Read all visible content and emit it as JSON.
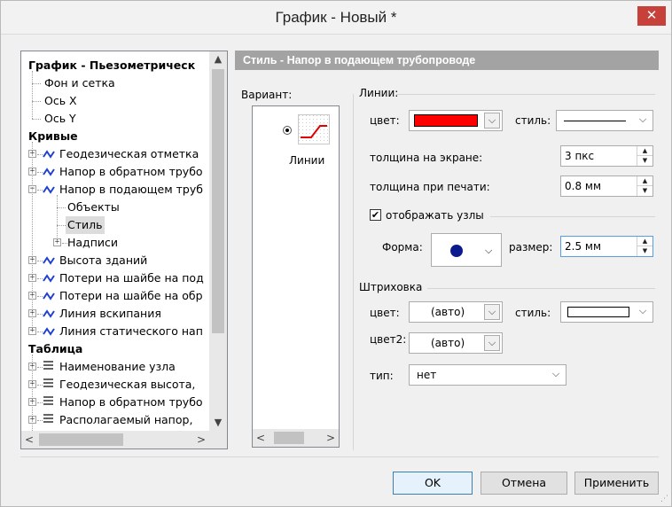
{
  "window": {
    "title": "График - Новый *",
    "close_glyph": "✕"
  },
  "tree": {
    "nodes": [
      {
        "label": "График - Пьезометрическ",
        "bold": true
      },
      {
        "label": "Фон и сетка"
      },
      {
        "label": "Ось X"
      },
      {
        "label": "Ось Y"
      },
      {
        "label": "Кривые",
        "bold": true
      },
      {
        "label": "Геодезическая отметка",
        "icon": "curve-icon",
        "expander": "+"
      },
      {
        "label": "Напор в обратном трубо",
        "icon": "curve-icon",
        "expander": "+"
      },
      {
        "label": "Напор в подающем труб",
        "icon": "curve-icon",
        "expander": "−"
      },
      {
        "label": "Объекты"
      },
      {
        "label": "Стиль",
        "selected": true
      },
      {
        "label": "Надписи",
        "expander": "+"
      },
      {
        "label": "Высота зданий",
        "icon": "curve-icon",
        "expander": "+"
      },
      {
        "label": "Потери на шайбе на под",
        "icon": "curve-icon",
        "expander": "+"
      },
      {
        "label": "Потери на шайбе на обр",
        "icon": "curve-icon",
        "expander": "+"
      },
      {
        "label": "Линия вскипания",
        "icon": "curve-icon",
        "expander": "+"
      },
      {
        "label": "Линия статического нап",
        "icon": "curve-icon",
        "expander": "+"
      },
      {
        "label": "Таблица",
        "bold": true
      },
      {
        "label": "Наименование узла",
        "icon": "table-lines-icon",
        "expander": "+"
      },
      {
        "label": "Геодезическая высота,",
        "icon": "table-lines-icon",
        "expander": "+"
      },
      {
        "label": "Напор в обратном трубо",
        "icon": "table-lines-icon",
        "expander": "+"
      },
      {
        "label": "Располагаемый напор,",
        "icon": "table-lines-icon",
        "expander": "+"
      }
    ],
    "scroll_up": "▲",
    "scroll_down": "▼",
    "scroll_left": "<",
    "scroll_right": ">"
  },
  "panel": {
    "header": "Стиль - Напор в подающем трубопроводе",
    "variant_label": "Вариант:",
    "variant_item_label": "Линии",
    "lines": {
      "group_label": "Линии:",
      "color_label": "цвет:",
      "color_value": "#ff0000",
      "style_label": "стиль:",
      "screen_thickness_label": "толщина на экране:",
      "screen_thickness_value": "3 пкс",
      "print_thickness_label": "толщина при печати:",
      "print_thickness_value": "0.8 мм",
      "show_nodes_label": "отображать узлы",
      "show_nodes_checked": true,
      "shape_label": "Форма:",
      "size_label": "размер:",
      "size_value": "2.5 мм"
    },
    "hatch": {
      "group_label": "Штриховка",
      "color_label": "цвет:",
      "color_value": "(авто)",
      "style_label": "стиль:",
      "color2_label": "цвет2:",
      "color2_value": "(авто)",
      "type_label": "тип:",
      "type_value": "нет"
    }
  },
  "buttons": {
    "ok": "OK",
    "cancel": "Отмена",
    "apply": "Применить"
  },
  "glyphs": {
    "dropdown": "⌵",
    "spin_up": "▲",
    "spin_down": "▼",
    "check": "✔",
    "grip": "⋰"
  },
  "colors": {
    "accent_header": "#a3a3a3",
    "close_button": "#c7403a",
    "node_marker": "#0b1a8c",
    "curve_icon": "#2040d0"
  }
}
